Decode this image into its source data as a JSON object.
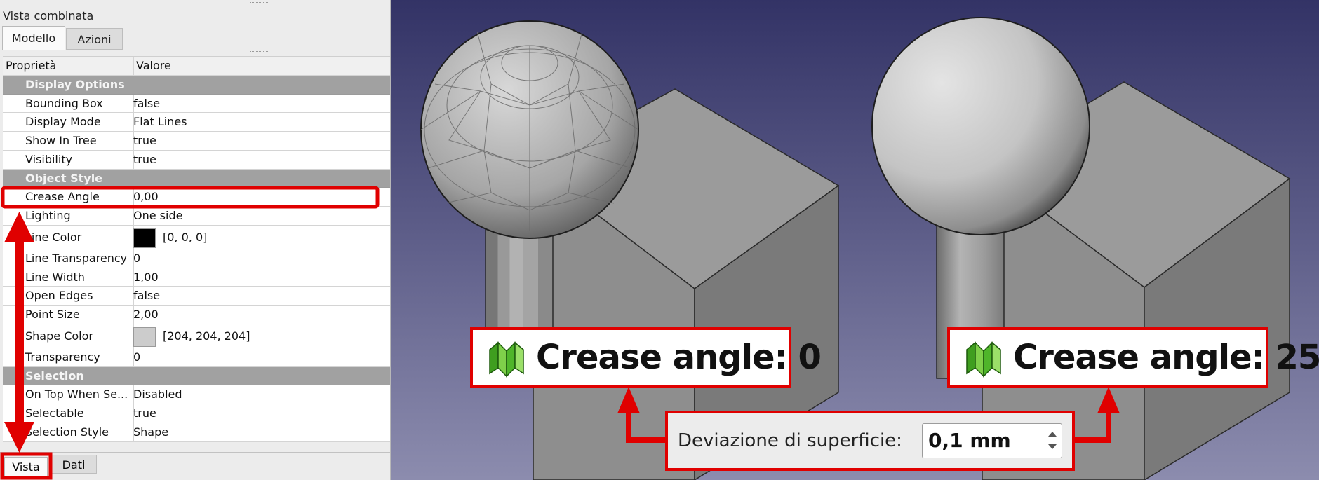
{
  "panel": {
    "title": "Vista combinata",
    "tabs": [
      {
        "label": "Modello"
      },
      {
        "label": "Azioni"
      }
    ],
    "header": {
      "property": "Proprietà",
      "value": "Valore"
    },
    "rows": [
      {
        "kind": "group",
        "name": "Display Options",
        "value": ""
      },
      {
        "kind": "prop",
        "name": "Bounding Box",
        "value": "false"
      },
      {
        "kind": "prop",
        "name": "Display Mode",
        "value": "Flat Lines"
      },
      {
        "kind": "prop",
        "name": "Show In Tree",
        "value": "true"
      },
      {
        "kind": "prop",
        "name": "Visibility",
        "value": "true"
      },
      {
        "kind": "group",
        "name": "Object Style",
        "value": ""
      },
      {
        "kind": "prop",
        "name": "Crease Angle",
        "value": "0,00"
      },
      {
        "kind": "prop",
        "name": "Lighting",
        "value": "One side"
      },
      {
        "kind": "color",
        "name": "Line Color",
        "value": "[0, 0, 0]",
        "swatch": "#000000"
      },
      {
        "kind": "prop",
        "name": "Line Transparency",
        "value": "0"
      },
      {
        "kind": "prop",
        "name": "Line Width",
        "value": "1,00"
      },
      {
        "kind": "prop",
        "name": "Open Edges",
        "value": "false"
      },
      {
        "kind": "prop",
        "name": "Point Size",
        "value": "2,00"
      },
      {
        "kind": "color",
        "name": "Shape Color",
        "value": "[204, 204, 204]",
        "swatch": "#cccccc"
      },
      {
        "kind": "prop",
        "name": "Transparency",
        "value": "0"
      },
      {
        "kind": "group",
        "name": "Selection",
        "value": ""
      },
      {
        "kind": "prop",
        "name": "On Top When Se...",
        "value": "Disabled"
      },
      {
        "kind": "prop",
        "name": "Selectable",
        "value": "true"
      },
      {
        "kind": "prop",
        "name": "Selection Style",
        "value": "Shape"
      }
    ],
    "bottom_tabs": [
      {
        "label": "Vista"
      },
      {
        "label": "Dati"
      }
    ]
  },
  "callouts": {
    "left": "Crease angle: 0",
    "right": "Crease angle: 25",
    "deviation_label": "Deviazione di superficie:",
    "deviation_value": "0,1 mm"
  },
  "colors": {
    "highlight": "#e00000",
    "viewport_top": "#333366",
    "viewport_bottom": "#8c8cae"
  }
}
